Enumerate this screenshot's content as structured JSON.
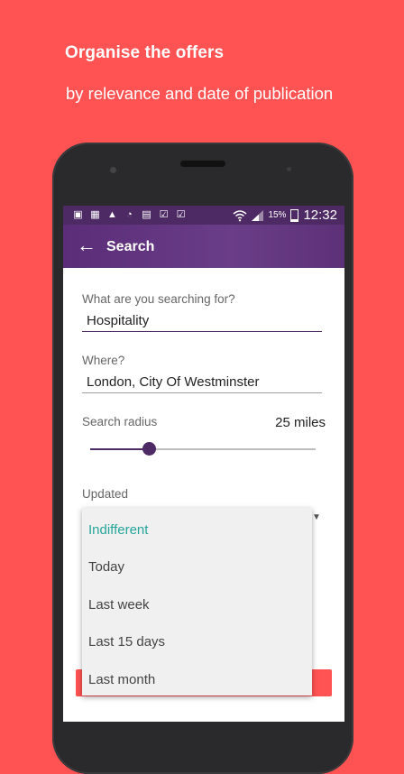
{
  "promo": {
    "title": "Organise the offers",
    "subtitle": "by relevance and date of publication"
  },
  "status_bar": {
    "battery_percent": "15%",
    "time": "12:32",
    "icons_left": [
      "image-icon",
      "gallery-icon",
      "warning-icon",
      "sync-icon",
      "sim-icon",
      "photo-check-icon",
      "photo-check-icon"
    ]
  },
  "app_bar": {
    "title": "Search",
    "back_icon": "arrow-back-icon"
  },
  "form": {
    "query_label": "What are you searching for?",
    "query_value": "Hospitality",
    "location_label": "Where?",
    "location_value": "London, City Of Westminster",
    "radius_label": "Search radius",
    "radius_value": "25 miles",
    "radius_slider_fraction": 0.26,
    "updated_label": "Updated"
  },
  "dropdown": {
    "options": [
      "Indifferent",
      "Today",
      "Last week",
      "Last 15 days",
      "Last month"
    ],
    "selected": "Indifferent"
  },
  "colors": {
    "background": "#ff5252",
    "primary": "#4d2a63",
    "accent": "#26a69a"
  }
}
